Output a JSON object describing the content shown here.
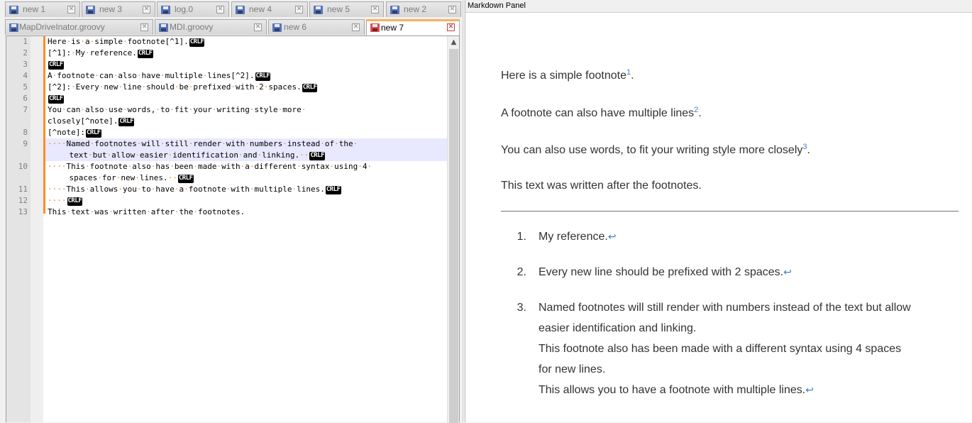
{
  "editor": {
    "tabs_row1": [
      {
        "label": "new 1"
      },
      {
        "label": "new 3"
      },
      {
        "label": "log.0"
      },
      {
        "label": "new 4"
      },
      {
        "label": "new 5"
      },
      {
        "label": "new 2"
      }
    ],
    "tabs_row2": [
      {
        "label": "MapDriveInator.groovy"
      },
      {
        "label": "MDI.groovy"
      },
      {
        "label": "new 6"
      },
      {
        "label": "new 7",
        "active": true
      }
    ],
    "crlf": "CRLF",
    "line_numbers": [
      "1",
      "2",
      "3",
      "4",
      "5",
      "6",
      "7",
      "8",
      "9",
      "10",
      "11",
      "12",
      "13"
    ],
    "lines": [
      "Here·is·a·simple·footnote[^1].",
      "[^1]:·My·reference.",
      "",
      "A·footnote·can·also·have·multiple·lines[^2].",
      "[^2]:·Every·new·line·should·be·prefixed·with·2·spaces.",
      "",
      "You·can·also·use·words,·to·fit·your·writing·style·more·",
      "closely[^note].",
      "[^note]:",
      "····Named·footnotes·will·still·render·with·numbers·instead·of·the·",
      "    text·but·allow·easier·identification·and·linking.··",
      "····This·footnote·also·has·been·made·with·a·different·syntax·using·4·",
      "    spaces·for·new·lines.··",
      "····This·allows·you·to·have·a·footnote·with·multiple·lines.",
      "····",
      "This·text·was·written·after·the·footnotes."
    ]
  },
  "markdown_panel": {
    "title": "Markdown Panel",
    "paragraphs": [
      {
        "text": "Here is a simple footnote",
        "sup": "1",
        "end": "."
      },
      {
        "text": "A footnote can also have multiple lines",
        "sup": "2",
        "end": "."
      },
      {
        "text": "You can also use words, to fit your writing style more closely",
        "sup": "3",
        "end": "."
      },
      {
        "text": "This text was written after the footnotes."
      }
    ],
    "footnotes": [
      {
        "num": "1.",
        "text": "My reference."
      },
      {
        "num": "2.",
        "text": "Every new line should be prefixed with 2 spaces."
      },
      {
        "num": "3.",
        "lines": [
          "Named footnotes will still render with numbers instead of the text but allow",
          "easier identification and linking.",
          "This footnote also has been made with a different syntax using 4 spaces",
          "for new lines.",
          "This allows you to have a footnote with multiple lines."
        ]
      }
    ],
    "backref": "↩"
  },
  "colors": {
    "active_tab_accent": "#fab060",
    "change_bar": "#ff8c2a",
    "link": "#4183c4",
    "highlight_line": "#e8e8ff"
  }
}
